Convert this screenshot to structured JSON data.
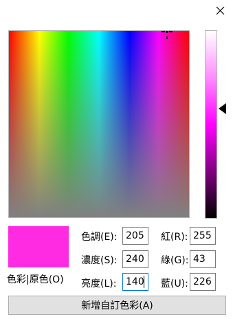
{
  "close_icon": "close-icon",
  "current_color": "#ff2be2",
  "swatch_label": "色彩|原色(O)",
  "fields": {
    "hue": {
      "label": "色調(E):",
      "value": "205"
    },
    "saturation": {
      "label": "濃度(S):",
      "value": "240"
    },
    "luminance": {
      "label": "亮度(L):",
      "value": "140"
    },
    "red": {
      "label": "紅(R):",
      "value": "255"
    },
    "green": {
      "label": "綠(G):",
      "value": "43"
    },
    "blue": {
      "label": "藍(U):",
      "value": "226"
    }
  },
  "add_button": "新增自訂色彩(A)"
}
